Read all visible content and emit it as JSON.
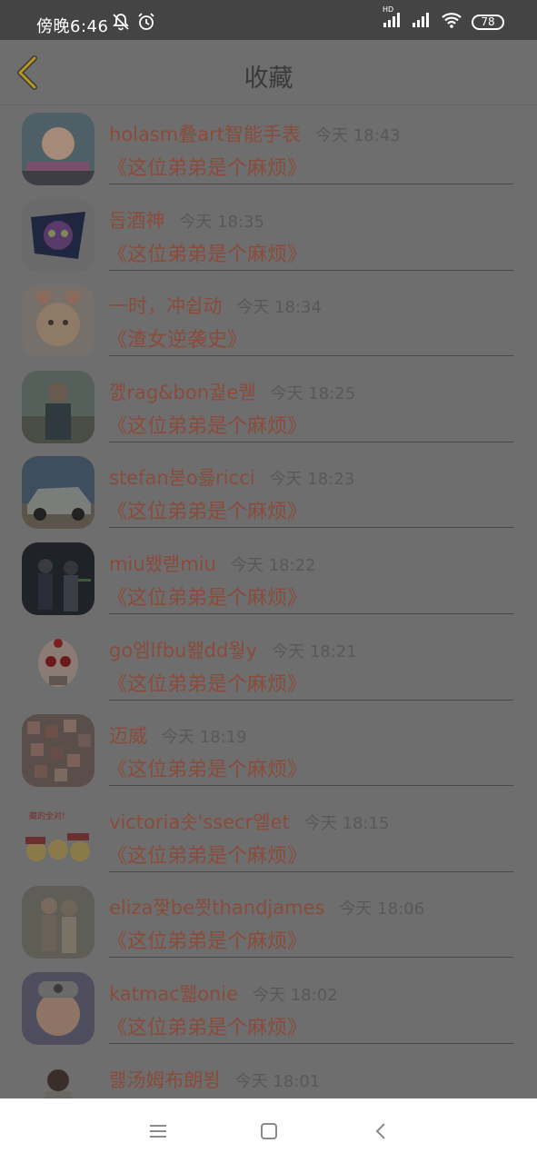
{
  "status": {
    "time": "傍晚6:46",
    "battery": "78",
    "network": "HD"
  },
  "header": {
    "title": "收藏"
  },
  "items": [
    {
      "name": "holasm叠art智能手表",
      "time": "今天 18:43",
      "book": "《这位弟弟是个麻烦》"
    },
    {
      "name": "돕酒神",
      "time": "今天 18:35",
      "book": "《这位弟弟是个麻烦》"
    },
    {
      "name": "一时，冲쉽动",
      "time": "今天 18:34",
      "book": "《渣女逆袭史》"
    },
    {
      "name": "꼜rag&bon궕e퀟",
      "time": "今天 18:25",
      "book": "《这位弟弟是个麻烦》"
    },
    {
      "name": "stefan붇o릃ricci",
      "time": "今天 18:23",
      "book": "《这位弟弟是个麻烦》"
    },
    {
      "name": "miu뵀랟miu",
      "time": "今天 18:22",
      "book": "《这位弟弟是个麻烦》"
    },
    {
      "name": "go엠lfbu뫮dd웧y",
      "time": "今天 18:21",
      "book": "《这位弟弟是个麻烦》"
    },
    {
      "name": "迈威",
      "time": "今天 18:19",
      "book": "《这位弟弟是个麻烦》"
    },
    {
      "name": "victoria솟'ssecr엘et",
      "time": "今天 18:15",
      "book": "《这位弟弟是个麻烦》"
    },
    {
      "name": "eliza짳be쬣thandjames",
      "time": "今天 18:06",
      "book": "《这位弟弟是个麻烦》"
    },
    {
      "name": "katmac뛟onie",
      "time": "今天 18:02",
      "book": "《这位弟弟是个麻烦》"
    },
    {
      "name": "럟汤姆布朗뵝",
      "time": "今天 18:01",
      "book": ""
    }
  ],
  "avatar_overlays": [
    "",
    "",
    "",
    "",
    "",
    "",
    "",
    "",
    "藏的全对!",
    "",
    "",
    ""
  ],
  "colors": {
    "accent": "#8a4b3a",
    "overlay": "#6e6e6e",
    "back_arrow": "#b7951f"
  }
}
